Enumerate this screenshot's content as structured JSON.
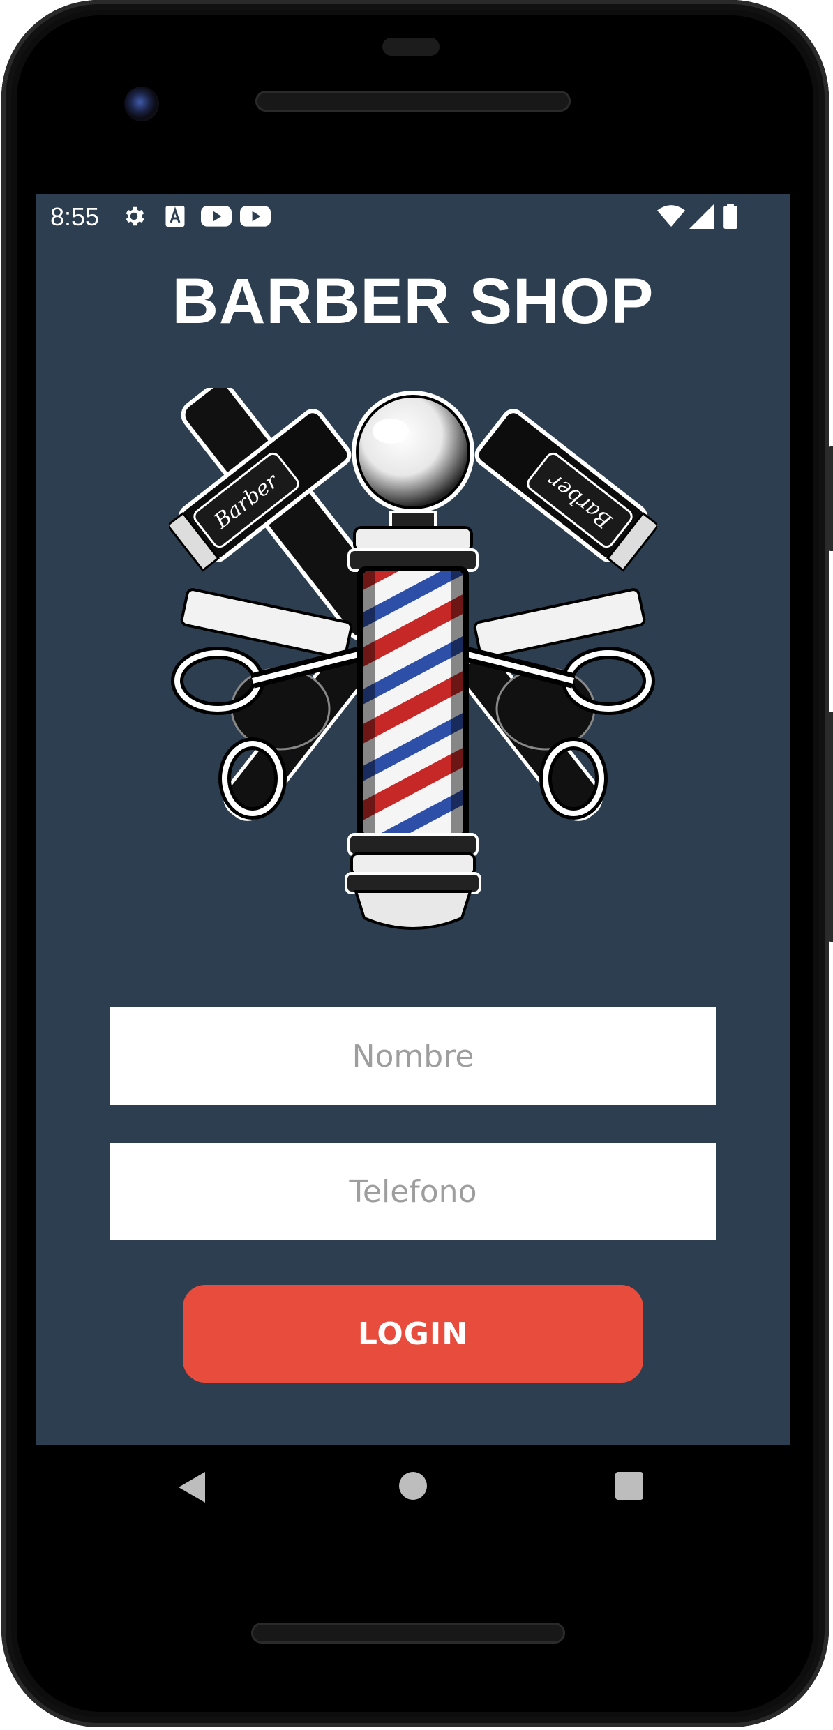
{
  "status_bar": {
    "time": "8:55",
    "left_icons": [
      "gear-icon",
      "text-a-icon",
      "youtube-icon",
      "youtube-icon"
    ],
    "right_icons": [
      "wifi-icon",
      "signal-icon",
      "battery-icon"
    ]
  },
  "app": {
    "title": "BARBER SHOP",
    "logo_icon": "barber-pole-emblem-icon",
    "logo_text_left": "Barber",
    "logo_text_right": "Barber"
  },
  "form": {
    "name_placeholder": "Nombre",
    "phone_placeholder": "Telefono",
    "login_label": "LOGIN"
  },
  "colors": {
    "background": "#2d3e50",
    "button": "#e74c3c",
    "pole_red": "#c62828",
    "pole_blue": "#2e4fa8"
  },
  "nav_bar": {
    "icons": [
      "back-icon",
      "home-icon",
      "recents-icon"
    ]
  }
}
